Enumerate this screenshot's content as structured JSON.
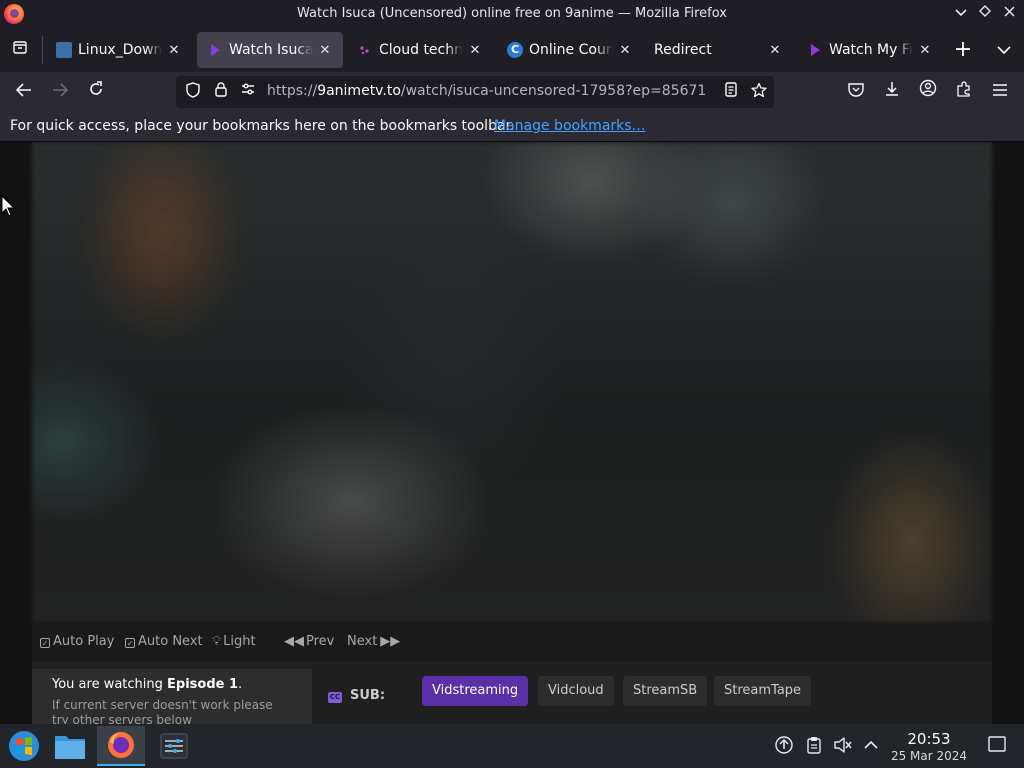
{
  "window": {
    "title": "Watch Isuca (Uncensored) online free on 9anime — Mozilla Firefox",
    "minimize_icon": "chevron-down-icon",
    "restore_icon": "diamond-icon",
    "close_icon": "close-icon"
  },
  "tabs": [
    {
      "label": "Linux_Downloads",
      "icon": "wiki-icon",
      "active": false
    },
    {
      "label": "Watch Isuca (Uncensored)",
      "icon": "play-icon",
      "active": true
    },
    {
      "label": "Cloud technology",
      "icon": "dots-icon",
      "active": false
    },
    {
      "label": "Online Courses",
      "icon": "c-logo-icon",
      "active": false
    },
    {
      "label": "Redirect",
      "icon": "",
      "active": false
    },
    {
      "label": "Watch My First Girlfriend",
      "icon": "play-icon",
      "active": false
    }
  ],
  "tab_close_glyph": "✕",
  "new_tab_glyph": "+",
  "tab_list_glyph": "⌄",
  "navbar": {
    "url_host": "9animetv.to",
    "url_prefix": "https://",
    "url_path": "/watch/isuca-uncensored-17958?ep=85671"
  },
  "bookmarks_bar": {
    "message": "For quick access, place your bookmarks here on the bookmarks toolbar.",
    "link": "Manage bookmarks…"
  },
  "player": {
    "controls": {
      "auto_play": "Auto Play",
      "auto_next": "Auto Next",
      "light": "Light",
      "prev": "Prev",
      "next": "Next"
    }
  },
  "episode": {
    "prefix": "You are watching ",
    "episode": "Episode 1",
    "suffix": ".",
    "hint": "If current server doesn't work please try other servers below"
  },
  "servers": {
    "type_label": "SUB:",
    "list": [
      "Vidstreaming",
      "Vidcloud",
      "StreamSB",
      "StreamTape"
    ],
    "selected": "Vidstreaming"
  },
  "taskbar": {
    "time": "20:53",
    "date": "25 Mar 2024"
  },
  "colors": {
    "accent": "#5b2fa8",
    "link": "#45a1ff",
    "taskbar_highlight": "#3daee9"
  }
}
